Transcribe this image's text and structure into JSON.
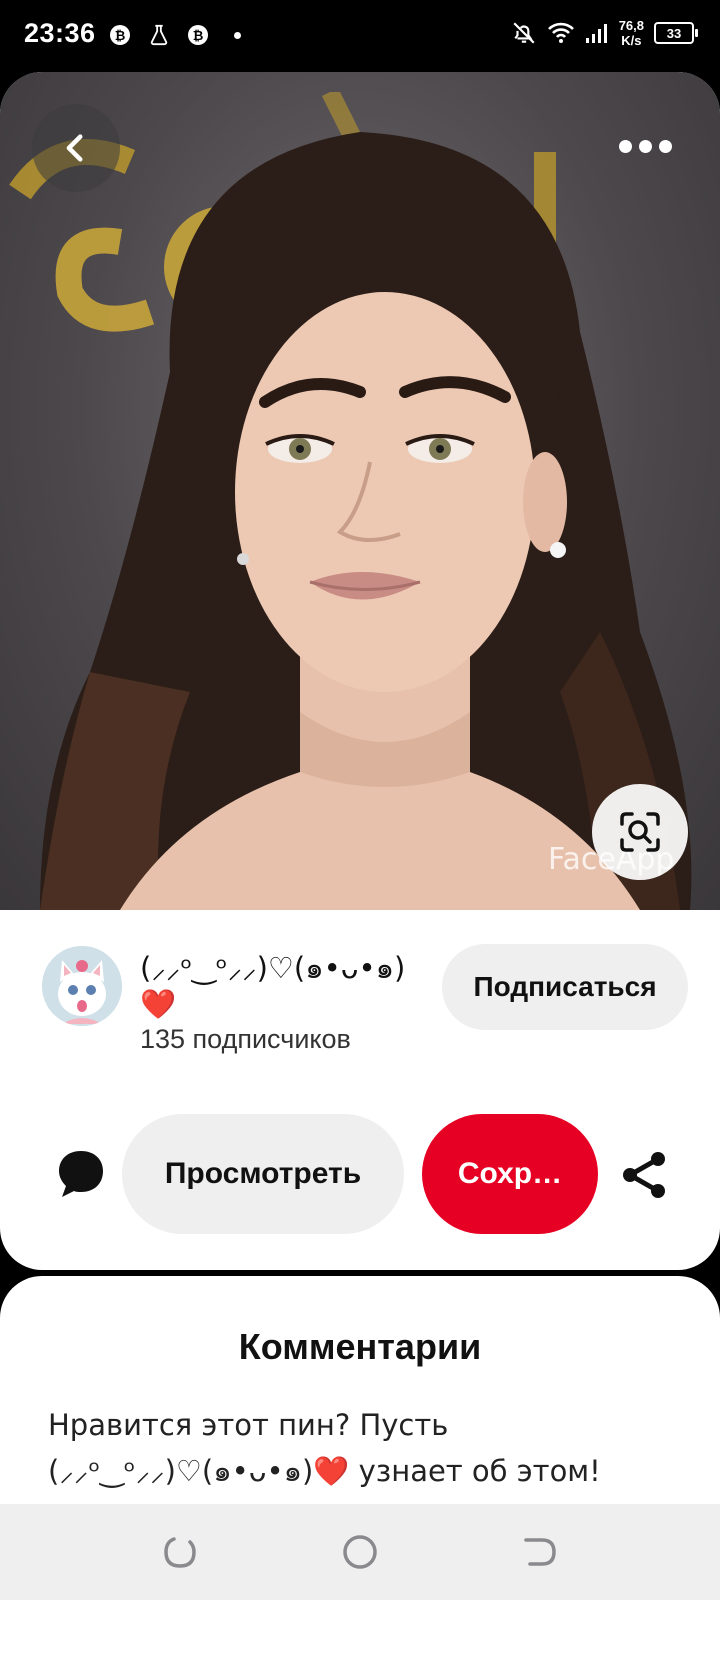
{
  "status_bar": {
    "time": "23:36",
    "net_speed_value": "76,8",
    "net_speed_unit": "K/s",
    "battery_level": "33",
    "icons": [
      "b-coin-icon",
      "flask-icon",
      "b-coin-icon",
      "dot-icon",
      "bell-off-icon",
      "wifi-icon",
      "signal-icon",
      "battery-icon"
    ]
  },
  "pin": {
    "image_description_icon": "portrait-photo",
    "watermark": "FaceApp",
    "back_icon": "chevron-left-icon",
    "more_icon": "more-horizontal-icon",
    "visual_search_icon": "visual-search-icon"
  },
  "creator": {
    "name": "(⸝⸝ᵒ‿ᵒ⸝⸝)♡(๑•ᴗ•๑)❤️",
    "followers": "135 подписчиков",
    "follow_label": "Подписаться"
  },
  "actions": {
    "view_label": "Просмотреть",
    "save_label": "Сохр…",
    "comment_icon": "comment-icon",
    "share_icon": "share-icon"
  },
  "comments": {
    "title": "Комментарии",
    "prompt": "Нравится этот пин? Пусть (⸝⸝ᵒ‿ᵒ⸝⸝)♡(๑•ᴗ•๑)❤️ узнает об этом!"
  },
  "colors": {
    "accent": "#e60023",
    "button_grey": "#efefef",
    "background": "#000000"
  }
}
